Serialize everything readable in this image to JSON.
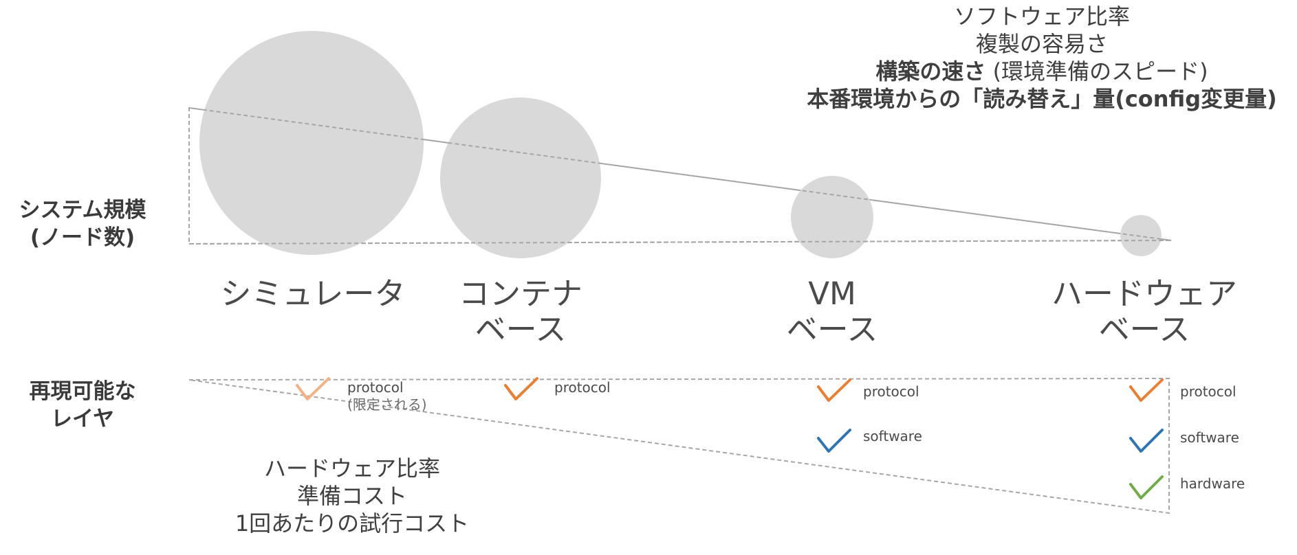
{
  "top_notes": {
    "line1": "ソフトウェア比率",
    "line2": "複製の容易さ",
    "line3_bold": "構築の速さ",
    "line3_rest": " (環境準備のスピード)",
    "line4": "本番環境からの「読み替え」量(config変更量)"
  },
  "axis_labels": {
    "system_scale_line1": "システム規模",
    "system_scale_line2": "(ノード数)",
    "layers_line1": "再現可能な",
    "layers_line2": "レイヤ"
  },
  "platforms": {
    "simulator": "シミュレータ",
    "container_line1": "コンテナ",
    "container_line2": "ベース",
    "vm_line1": "VM",
    "vm_line2": "ベース",
    "hardware_line1": "ハードウェア",
    "hardware_line2": "ベース"
  },
  "layers": {
    "simulator": {
      "protocol": "protocol",
      "note": "(限定される)"
    },
    "container": {
      "protocol": "protocol"
    },
    "vm": {
      "protocol": "protocol",
      "software": "software"
    },
    "hardware": {
      "protocol": "protocol",
      "software": "software",
      "hardware": "hardware"
    }
  },
  "bottom_notes": {
    "line1": "ハードウェア比率",
    "line2": "準備コスト",
    "line3": "1回あたりの試行コスト"
  },
  "colors": {
    "bubble": "#d9d9d9",
    "dashed_line": "#a6a6a6",
    "check_protocol": "#ed7d31",
    "check_protocol_faded": "#f4b183",
    "check_software": "#2e75b6",
    "check_hardware": "#70ad47"
  },
  "icons": {
    "check": "check-icon"
  }
}
